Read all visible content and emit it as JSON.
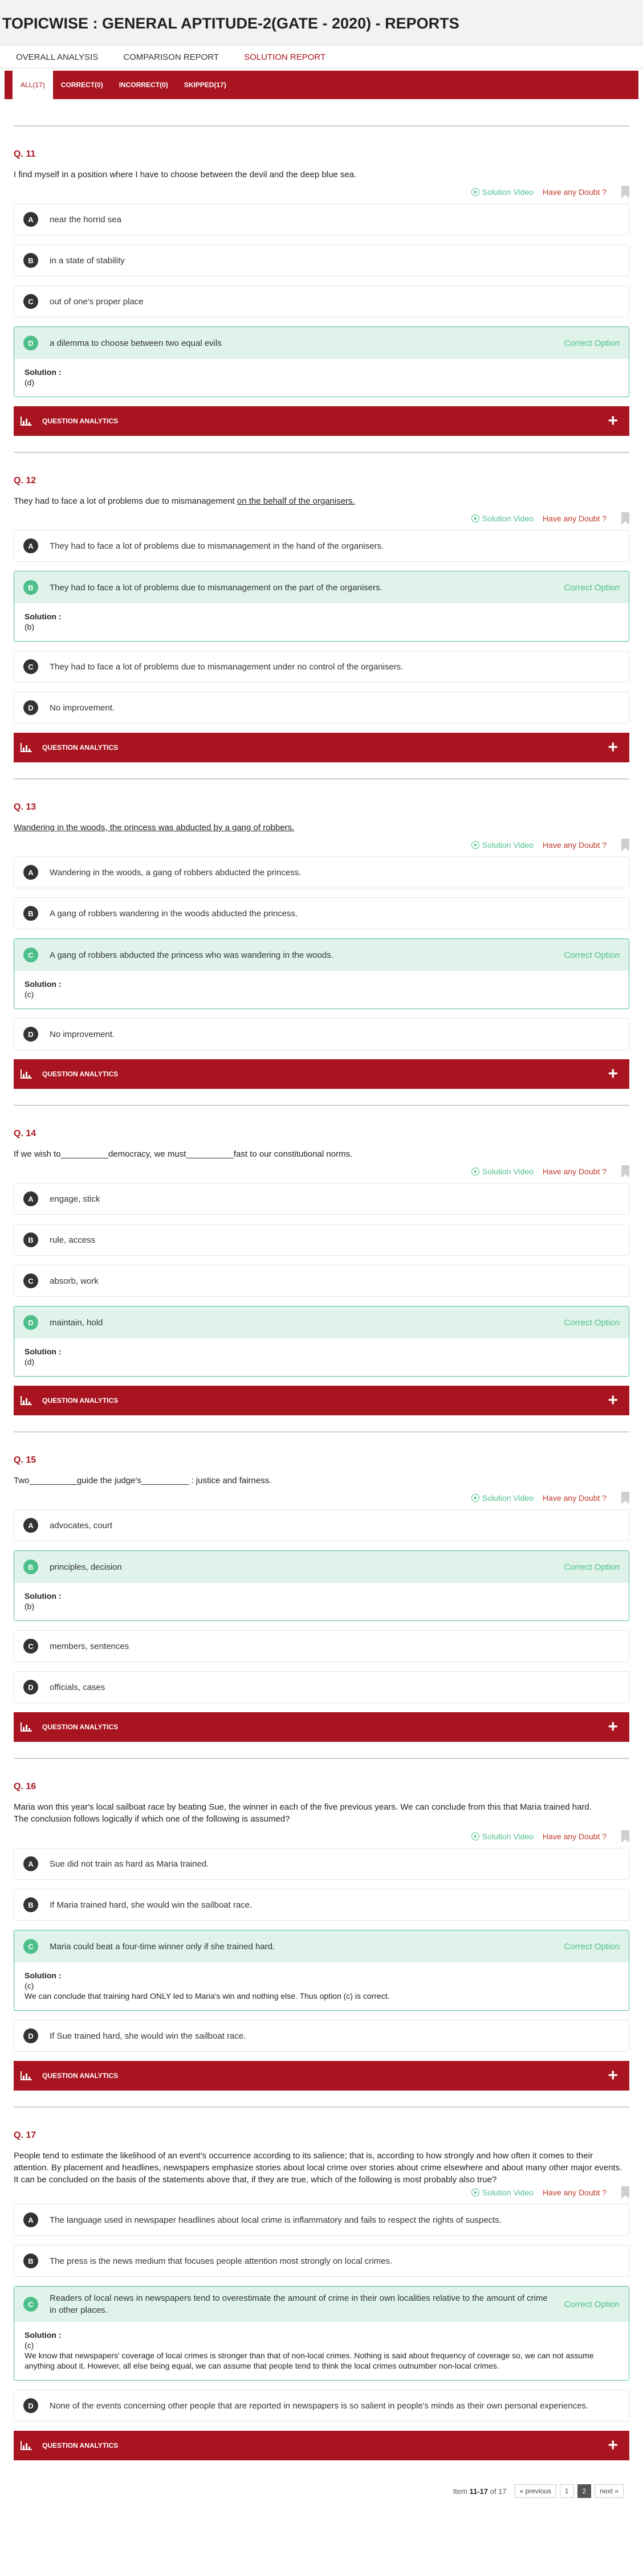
{
  "page_title": "TOPICWISE : GENERAL APTITUDE-2(GATE - 2020) - REPORTS",
  "top_tabs": [
    "OVERALL ANALYSIS",
    "COMPARISON REPORT",
    "SOLUTION REPORT"
  ],
  "filter_tabs": [
    "ALL(17)",
    "CORRECT(0)",
    "INCORRECT(0)",
    "SKIPPED(17)"
  ],
  "common": {
    "solution_video": "Solution Video",
    "doubt": "Have any Doubt ?",
    "correct_option": "Correct Option",
    "solution_label": "Solution :",
    "analytics_label": "QUESTION ANALYTICS",
    "plus": "+"
  },
  "questions": [
    {
      "number": "Q. 11",
      "text": "I find myself in a position where I have to choose between the devil and the deep blue sea.",
      "options": [
        {
          "letter": "A",
          "text": "near the horrid sea"
        },
        {
          "letter": "B",
          "text": "in a state of stability"
        },
        {
          "letter": "C",
          "text": "out of one's proper place"
        },
        {
          "letter": "D",
          "text": "a dilemma to choose between two equal evils"
        }
      ],
      "solution": [
        "(d)"
      ]
    },
    {
      "number": "Q. 12",
      "text_pre": "They had to face a lot of problems due to mismanagement ",
      "text_underlined": "on the behalf of the organisers.",
      "options": [
        {
          "letter": "A",
          "text": "They had to face a lot of problems due to mismanagement in the hand of the organisers."
        },
        {
          "letter": "B",
          "text": "They had to face a lot of problems due to mismanagement on the part of the organisers."
        },
        {
          "letter": "C",
          "text": "They had to face a lot of problems due to mismanagement under no control of the organisers."
        },
        {
          "letter": "D",
          "text": "No improvement."
        }
      ],
      "solution": [
        "(b)"
      ]
    },
    {
      "number": "Q. 13",
      "text_underlined": "Wandering in the woods, the princess was abducted by a gang of robbers.",
      "options": [
        {
          "letter": "A",
          "text": "Wandering in the woods, a gang of robbers abducted the princess."
        },
        {
          "letter": "B",
          "text": "A gang of robbers wandering in the woods abducted the princess."
        },
        {
          "letter": "C",
          "text": "A gang of robbers abducted the princess who was wandering in the woods."
        },
        {
          "letter": "D",
          "text": "No improvement."
        }
      ],
      "solution": [
        "(c)"
      ]
    },
    {
      "number": "Q. 14",
      "text": "If we wish to__________democracy, we must__________fast to our constitutional norms.",
      "options": [
        {
          "letter": "A",
          "text": "engage, stick"
        },
        {
          "letter": "B",
          "text": "rule, access"
        },
        {
          "letter": "C",
          "text": "absorb, work"
        },
        {
          "letter": "D",
          "text": "maintain, hold"
        }
      ],
      "solution": [
        "(d)"
      ]
    },
    {
      "number": "Q. 15",
      "text": "Two__________guide the judge's__________ : justice and fairness.",
      "options": [
        {
          "letter": "A",
          "text": "advocates, court"
        },
        {
          "letter": "B",
          "text": "principles, decision"
        },
        {
          "letter": "C",
          "text": "members, sentences"
        },
        {
          "letter": "D",
          "text": "officials, cases"
        }
      ],
      "solution": [
        "(b)"
      ]
    },
    {
      "number": "Q. 16",
      "text_lines": [
        "Maria won this year's local sailboat race by beating Sue, the winner in each of the five previous years. We can conclude from this that Maria trained hard.",
        "The conclusion follows logically if which one of the following is assumed?"
      ],
      "options": [
        {
          "letter": "A",
          "text": "Sue did not train as hard as Maria trained."
        },
        {
          "letter": "B",
          "text": "If Maria trained hard, she would win the sailboat race."
        },
        {
          "letter": "C",
          "text": "Maria could beat a four-time winner only if she trained hard."
        },
        {
          "letter": "D",
          "text": "If Sue trained hard, she would win the sailboat race."
        }
      ],
      "solution": [
        "(c)",
        "We can conclude that training hard ONLY led to Maria's win and nothing else. Thus option (c) is correct."
      ]
    },
    {
      "number": "Q. 17",
      "text_lines": [
        "People tend to estimate the likelihood of an event's occurrence according to its salience; that is, according to how strongly and how often it comes to their attention. By placement and headlines, newspapers emphasize stories about local crime over stories about crime elsewhere and about many other major events.",
        "It can be concluded on the basis of the statements above that, if they are true, which of the following is most probably also true?"
      ],
      "options": [
        {
          "letter": "A",
          "text": "The language used in newspaper headlines about local crime is inflammatory and fails to respect the rights of suspects."
        },
        {
          "letter": "B",
          "text": "The press is the news medium that focuses people attention most strongly on local crimes."
        },
        {
          "letter": "C",
          "text": "Readers of local news in newspapers tend to overestimate the amount of crime in their own localities relative to the amount of crime in other places."
        },
        {
          "letter": "D",
          "text": "None of the events concerning other people that are reported in newspapers is so salient in people's minds as their own personal experiences."
        }
      ],
      "solution": [
        "(c)",
        "We know that newspapers' coverage of local crimes is stronger than that of non-local crimes. Nothing is said about frequency of coverage so, we can not assume anything about it. However, all else being equal, we can assume that people tend to think the local crimes outnumber non-local crimes."
      ]
    }
  ],
  "pager": {
    "item_prefix": "Item ",
    "item_range": "11-17",
    "item_suffix": " of 17",
    "previous": "« previous",
    "page1": "1",
    "page2": "2",
    "next": "next »"
  }
}
